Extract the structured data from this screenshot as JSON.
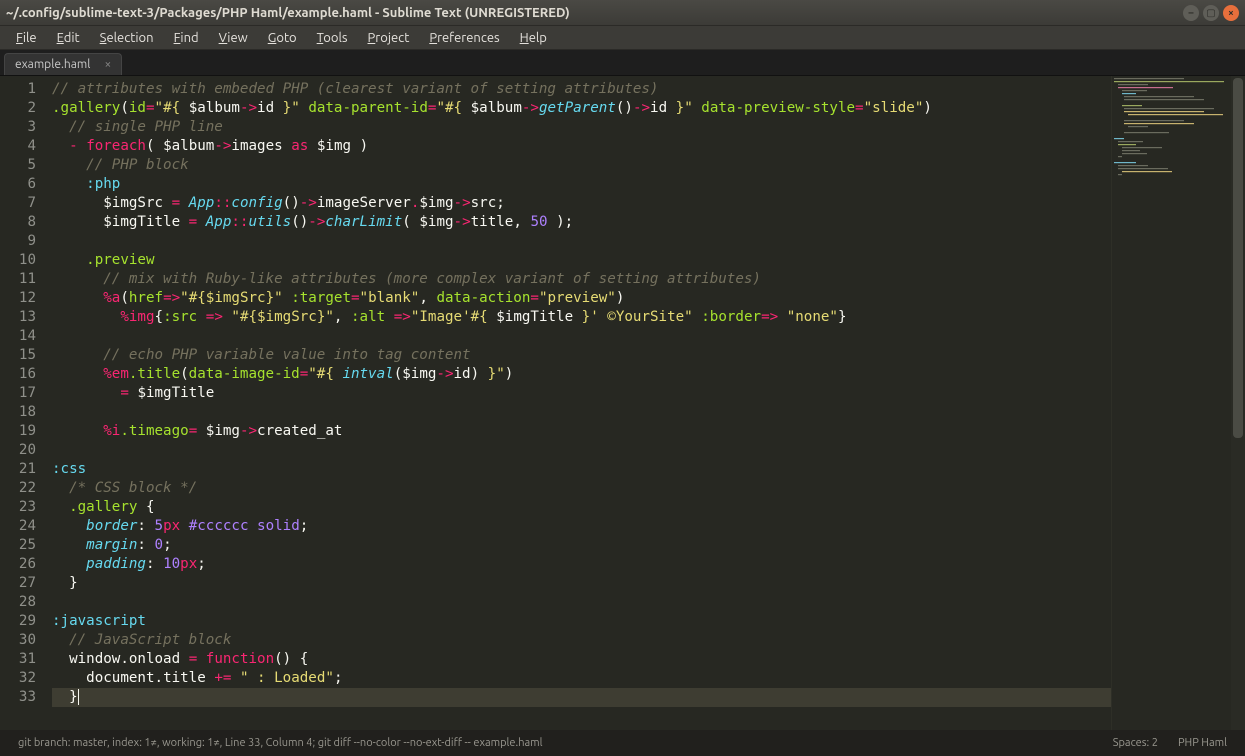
{
  "window": {
    "title": "~/.config/sublime-text-3/Packages/PHP Haml/example.haml - Sublime Text (UNREGISTERED)"
  },
  "menu": [
    "File",
    "Edit",
    "Selection",
    "Find",
    "View",
    "Goto",
    "Tools",
    "Project",
    "Preferences",
    "Help"
  ],
  "tab": {
    "name": "example.haml"
  },
  "lines": 33,
  "code": [
    {
      "n": 1,
      "seg": [
        [
          "c-comment",
          "// attributes with embeded PHP (clearest variant of setting attributes)"
        ]
      ]
    },
    {
      "n": 2,
      "seg": [
        [
          "c-sel",
          ".gallery"
        ],
        [
          "c-punc",
          "("
        ],
        [
          "c-attr",
          "id"
        ],
        [
          "c-op",
          "="
        ],
        [
          "c-str",
          "\"#{ "
        ],
        [
          "c-var",
          "$album"
        ],
        [
          "c-op",
          "->"
        ],
        [
          "c-var",
          "id"
        ],
        [
          "c-str",
          " }\""
        ],
        [
          "c-punc",
          " "
        ],
        [
          "c-attr",
          "data-parent-id"
        ],
        [
          "c-op",
          "="
        ],
        [
          "c-str",
          "\"#{ "
        ],
        [
          "c-var",
          "$album"
        ],
        [
          "c-op",
          "->"
        ],
        [
          "c-func",
          "getParent"
        ],
        [
          "c-punc",
          "()"
        ],
        [
          "c-op",
          "->"
        ],
        [
          "c-var",
          "id"
        ],
        [
          "c-str",
          " }\""
        ],
        [
          "c-punc",
          " "
        ],
        [
          "c-attr",
          "data-preview-style"
        ],
        [
          "c-op",
          "="
        ],
        [
          "c-str",
          "\"slide\""
        ],
        [
          "c-punc",
          ")"
        ]
      ]
    },
    {
      "n": 3,
      "seg": [
        [
          "",
          "  "
        ],
        [
          "c-comment",
          "// single PHP line"
        ]
      ]
    },
    {
      "n": 4,
      "seg": [
        [
          "",
          "  "
        ],
        [
          "c-op",
          "- "
        ],
        [
          "c-kw",
          "foreach"
        ],
        [
          "c-punc",
          "( "
        ],
        [
          "c-var",
          "$album"
        ],
        [
          "c-op",
          "->"
        ],
        [
          "c-var",
          "images"
        ],
        [
          "c-punc",
          " "
        ],
        [
          "c-kw",
          "as"
        ],
        [
          "c-punc",
          " "
        ],
        [
          "c-var",
          "$img"
        ],
        [
          "c-punc",
          " )"
        ]
      ]
    },
    {
      "n": 5,
      "seg": [
        [
          "",
          "    "
        ],
        [
          "c-comment",
          "// PHP block"
        ]
      ]
    },
    {
      "n": 6,
      "seg": [
        [
          "",
          "    "
        ],
        [
          "c-filt",
          ":php"
        ]
      ]
    },
    {
      "n": 7,
      "seg": [
        [
          "",
          "      "
        ],
        [
          "c-var",
          "$imgSrc"
        ],
        [
          "c-punc",
          " "
        ],
        [
          "c-op",
          "="
        ],
        [
          "c-punc",
          " "
        ],
        [
          "c-class",
          "App"
        ],
        [
          "c-op",
          "::"
        ],
        [
          "c-func",
          "config"
        ],
        [
          "c-punc",
          "()"
        ],
        [
          "c-op",
          "->"
        ],
        [
          "c-var",
          "imageServer"
        ],
        [
          "c-op",
          "."
        ],
        [
          "c-var",
          "$img"
        ],
        [
          "c-op",
          "->"
        ],
        [
          "c-var",
          "src"
        ],
        [
          "c-punc",
          ";"
        ]
      ]
    },
    {
      "n": 8,
      "seg": [
        [
          "",
          "      "
        ],
        [
          "c-var",
          "$imgTitle"
        ],
        [
          "c-punc",
          " "
        ],
        [
          "c-op",
          "="
        ],
        [
          "c-punc",
          " "
        ],
        [
          "c-class",
          "App"
        ],
        [
          "c-op",
          "::"
        ],
        [
          "c-func",
          "utils"
        ],
        [
          "c-punc",
          "()"
        ],
        [
          "c-op",
          "->"
        ],
        [
          "c-func",
          "charLimit"
        ],
        [
          "c-punc",
          "( "
        ],
        [
          "c-var",
          "$img"
        ],
        [
          "c-op",
          "->"
        ],
        [
          "c-var",
          "title"
        ],
        [
          "c-punc",
          ", "
        ],
        [
          "c-num",
          "50"
        ],
        [
          "c-punc",
          " );"
        ]
      ]
    },
    {
      "n": 9,
      "seg": [
        [
          "",
          ""
        ]
      ]
    },
    {
      "n": 10,
      "seg": [
        [
          "",
          "    "
        ],
        [
          "c-sel",
          ".preview"
        ]
      ]
    },
    {
      "n": 11,
      "seg": [
        [
          "",
          "      "
        ],
        [
          "c-comment",
          "// mix with Ruby-like attributes (more complex variant of setting attributes)"
        ]
      ]
    },
    {
      "n": 12,
      "seg": [
        [
          "",
          "      "
        ],
        [
          "c-tag",
          "%a"
        ],
        [
          "c-punc",
          "("
        ],
        [
          "c-attr",
          "href"
        ],
        [
          "c-op",
          "=>"
        ],
        [
          "c-str",
          "\"#{$imgSrc}\""
        ],
        [
          "c-punc",
          " "
        ],
        [
          "c-attr",
          ":target"
        ],
        [
          "c-op",
          "="
        ],
        [
          "c-str",
          "\"blank\""
        ],
        [
          "c-punc",
          ", "
        ],
        [
          "c-attr",
          "data-action"
        ],
        [
          "c-op",
          "="
        ],
        [
          "c-str",
          "\"preview\""
        ],
        [
          "c-punc",
          ")"
        ]
      ]
    },
    {
      "n": 13,
      "seg": [
        [
          "",
          "        "
        ],
        [
          "c-tag",
          "%img"
        ],
        [
          "c-punc",
          "{"
        ],
        [
          "c-attr",
          ":src"
        ],
        [
          "c-punc",
          " "
        ],
        [
          "c-op",
          "=>"
        ],
        [
          "c-punc",
          " "
        ],
        [
          "c-str",
          "\"#{$imgSrc}\""
        ],
        [
          "c-punc",
          ", "
        ],
        [
          "c-attr",
          ":alt"
        ],
        [
          "c-punc",
          " "
        ],
        [
          "c-op",
          "=>"
        ],
        [
          "c-str",
          "\"Image'"
        ],
        [
          "c-str",
          "#{ "
        ],
        [
          "c-var",
          "$imgTitle"
        ],
        [
          "c-str",
          " }"
        ],
        [
          "c-str",
          "' ©YourSite\""
        ],
        [
          "c-punc",
          " "
        ],
        [
          "c-attr",
          ":border"
        ],
        [
          "c-op",
          "=>"
        ],
        [
          "c-punc",
          " "
        ],
        [
          "c-str",
          "\"none\""
        ],
        [
          "c-punc",
          "}"
        ]
      ]
    },
    {
      "n": 14,
      "seg": [
        [
          "",
          ""
        ]
      ]
    },
    {
      "n": 15,
      "seg": [
        [
          "",
          "      "
        ],
        [
          "c-comment",
          "// echo PHP variable value into tag content"
        ]
      ]
    },
    {
      "n": 16,
      "seg": [
        [
          "",
          "      "
        ],
        [
          "c-tag",
          "%em"
        ],
        [
          "c-sel",
          ".title"
        ],
        [
          "c-punc",
          "("
        ],
        [
          "c-attr",
          "data-image-id"
        ],
        [
          "c-op",
          "="
        ],
        [
          "c-str",
          "\"#{ "
        ],
        [
          "c-func",
          "intval"
        ],
        [
          "c-punc",
          "("
        ],
        [
          "c-var",
          "$img"
        ],
        [
          "c-op",
          "->"
        ],
        [
          "c-var",
          "id"
        ],
        [
          "c-punc",
          ")"
        ],
        [
          "c-str",
          " }\""
        ],
        [
          "c-punc",
          ")"
        ]
      ]
    },
    {
      "n": 17,
      "seg": [
        [
          "",
          "        "
        ],
        [
          "c-op",
          "= "
        ],
        [
          "c-var",
          "$imgTitle"
        ]
      ]
    },
    {
      "n": 18,
      "seg": [
        [
          "",
          ""
        ]
      ]
    },
    {
      "n": 19,
      "seg": [
        [
          "",
          "      "
        ],
        [
          "c-tag",
          "%i"
        ],
        [
          "c-sel",
          ".timeago"
        ],
        [
          "c-op",
          "= "
        ],
        [
          "c-var",
          "$img"
        ],
        [
          "c-op",
          "->"
        ],
        [
          "c-var",
          "created_at"
        ]
      ]
    },
    {
      "n": 20,
      "seg": [
        [
          "",
          ""
        ]
      ]
    },
    {
      "n": 21,
      "seg": [
        [
          "c-filt",
          ":css"
        ]
      ]
    },
    {
      "n": 22,
      "seg": [
        [
          "",
          "  "
        ],
        [
          "c-comment",
          "/* CSS block */"
        ]
      ]
    },
    {
      "n": 23,
      "seg": [
        [
          "",
          "  "
        ],
        [
          "c-sel",
          ".gallery"
        ],
        [
          "c-punc",
          " {"
        ]
      ]
    },
    {
      "n": 24,
      "seg": [
        [
          "",
          "    "
        ],
        [
          "c-css-prop",
          "border"
        ],
        [
          "c-punc",
          ": "
        ],
        [
          "c-num",
          "5"
        ],
        [
          "c-kw",
          "px"
        ],
        [
          "c-punc",
          " "
        ],
        [
          "c-css-val",
          "#cccccc"
        ],
        [
          "c-punc",
          " "
        ],
        [
          "c-css-val",
          "solid"
        ],
        [
          "c-punc",
          ";"
        ]
      ]
    },
    {
      "n": 25,
      "seg": [
        [
          "",
          "    "
        ],
        [
          "c-css-prop",
          "margin"
        ],
        [
          "c-punc",
          ": "
        ],
        [
          "c-num",
          "0"
        ],
        [
          "c-punc",
          ";"
        ]
      ]
    },
    {
      "n": 26,
      "seg": [
        [
          "",
          "    "
        ],
        [
          "c-css-prop",
          "padding"
        ],
        [
          "c-punc",
          ": "
        ],
        [
          "c-num",
          "10"
        ],
        [
          "c-kw",
          "px"
        ],
        [
          "c-punc",
          ";"
        ]
      ]
    },
    {
      "n": 27,
      "seg": [
        [
          "",
          "  "
        ],
        [
          "c-punc",
          "}"
        ]
      ]
    },
    {
      "n": 28,
      "seg": [
        [
          "",
          ""
        ]
      ]
    },
    {
      "n": 29,
      "seg": [
        [
          "c-filt",
          ":javascript"
        ]
      ]
    },
    {
      "n": 30,
      "seg": [
        [
          "",
          "  "
        ],
        [
          "c-comment",
          "// JavaScript block"
        ]
      ]
    },
    {
      "n": 31,
      "seg": [
        [
          "",
          "  "
        ],
        [
          "c-var",
          "window"
        ],
        [
          "c-punc",
          "."
        ],
        [
          "c-var",
          "onload"
        ],
        [
          "c-punc",
          " "
        ],
        [
          "c-op",
          "="
        ],
        [
          "c-punc",
          " "
        ],
        [
          "c-kw",
          "function"
        ],
        [
          "c-punc",
          "() {"
        ]
      ]
    },
    {
      "n": 32,
      "seg": [
        [
          "",
          "    "
        ],
        [
          "c-var",
          "document"
        ],
        [
          "c-punc",
          "."
        ],
        [
          "c-var",
          "title"
        ],
        [
          "c-punc",
          " "
        ],
        [
          "c-op",
          "+="
        ],
        [
          "c-punc",
          " "
        ],
        [
          "c-str",
          "\" : Loaded\""
        ],
        [
          "c-punc",
          ";"
        ]
      ]
    },
    {
      "n": 33,
      "hl": true,
      "seg": [
        [
          "",
          "  "
        ],
        [
          "c-punc",
          "}"
        ]
      ]
    }
  ],
  "status": {
    "left": "git branch: master, index: 1≠, working: 1≠, Line 33, Column 4; git diff --no-color --no-ext-diff -- example.haml",
    "spaces": "Spaces: 2",
    "syntax": "PHP Haml"
  }
}
